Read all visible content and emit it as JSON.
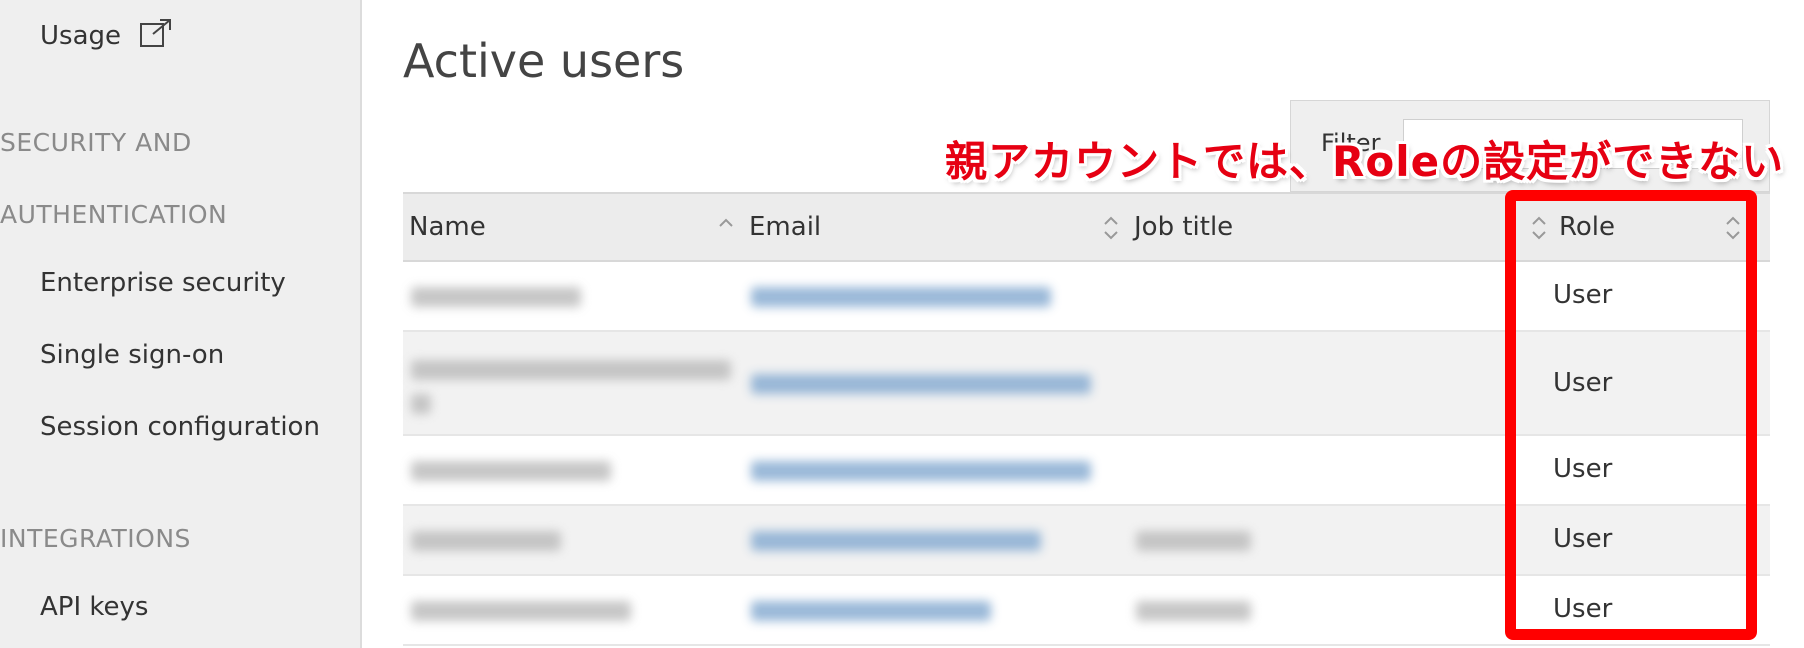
{
  "sidebar": {
    "usage_label": "Usage",
    "security_heading_line1": "SECURITY AND",
    "security_heading_line2": "AUTHENTICATION",
    "items": [
      {
        "label": "Enterprise security"
      },
      {
        "label": "Single sign-on"
      },
      {
        "label": "Session configuration"
      }
    ],
    "integrations_heading": "INTEGRATIONS",
    "api_keys_label": "API keys"
  },
  "main": {
    "title": "Active users",
    "filter_label": "Filter"
  },
  "table": {
    "columns": [
      {
        "label": "Name"
      },
      {
        "label": "Email"
      },
      {
        "label": "Job title"
      },
      {
        "label": "Role"
      }
    ],
    "rows": [
      {
        "role": "User"
      },
      {
        "role": "User"
      },
      {
        "role": "User"
      },
      {
        "role": "User"
      },
      {
        "role": "User"
      }
    ]
  },
  "annotation": {
    "text": "親アカウントでは、Roleの設定ができない",
    "color": "#e60012",
    "box_color": "#ff0000"
  },
  "colors": {
    "sidebar_bg": "#efefef",
    "header_bg": "#ececec",
    "link_blue": "#8fb1d4"
  }
}
